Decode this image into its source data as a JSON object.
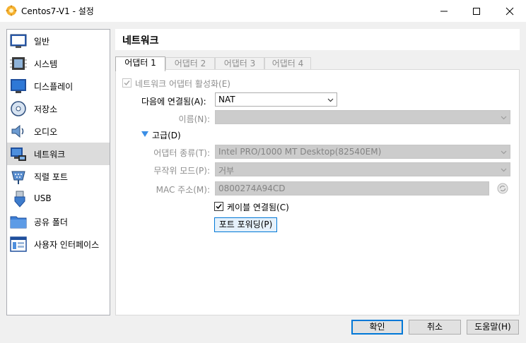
{
  "window": {
    "title": "Centos7-V1 - 설정",
    "minimize_icon": "minimize-icon",
    "maximize_icon": "maximize-icon",
    "close_icon": "close-icon"
  },
  "sidebar": {
    "items": [
      {
        "label": "일반",
        "icon": "general-icon"
      },
      {
        "label": "시스템",
        "icon": "system-chip-icon"
      },
      {
        "label": "디스플레이",
        "icon": "display-monitor-icon"
      },
      {
        "label": "저장소",
        "icon": "storage-disc-icon"
      },
      {
        "label": "오디오",
        "icon": "audio-speaker-icon"
      },
      {
        "label": "네트워크",
        "icon": "network-icon",
        "active": true
      },
      {
        "label": "직렬 포트",
        "icon": "serial-port-icon"
      },
      {
        "label": "USB",
        "icon": "usb-icon"
      },
      {
        "label": "공유 폴더",
        "icon": "shared-folder-icon"
      },
      {
        "label": "사용자 인터페이스",
        "icon": "user-interface-icon"
      }
    ]
  },
  "header": {
    "title": "네트워크"
  },
  "tabs": [
    {
      "label": "어댑터 1",
      "active": true
    },
    {
      "label": "어댑터 2",
      "active": false
    },
    {
      "label": "어댑터 3",
      "active": false
    },
    {
      "label": "어댑터 4",
      "active": false
    }
  ],
  "adapter": {
    "enable_label": "네트워크 어댑터 활성화(E)",
    "enable_checked": true,
    "attached_label": "다음에 연결됨(A):",
    "attached_value": "NAT",
    "name_label": "이름(N):",
    "name_value": "",
    "advanced_label": "고급(D)",
    "adapter_type_label": "어댑터 종류(T):",
    "adapter_type_value": "Intel PRO/1000 MT Desktop(82540EM)",
    "promisc_label": "무작위 모드(P):",
    "promisc_value": "거부",
    "mac_label": "MAC 주소(M):",
    "mac_value": "0800274A94CD",
    "mac_refresh_icon": "refresh-mac-icon",
    "cable_label": "케이블 연결됨(C)",
    "cable_checked": true,
    "port_forward_label": "포트 포워딩(P)"
  },
  "footer": {
    "ok_label": "확인",
    "cancel_label": "취소",
    "help_label": "도움말(H)"
  },
  "colors": {
    "accent": "#0078d7",
    "selected_item": "#dcdcdc",
    "disabled_field": "#cccccc",
    "disabled_text": "#8e8e8e"
  }
}
